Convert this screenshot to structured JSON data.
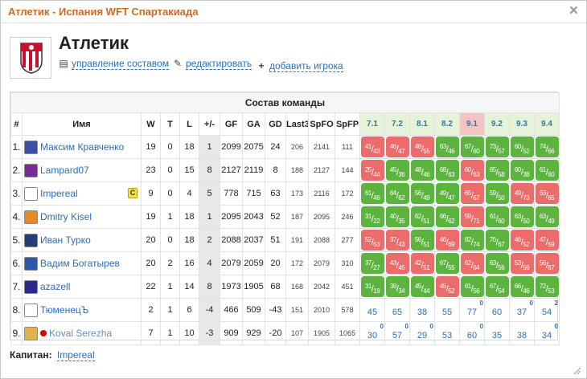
{
  "window": {
    "title": "Атлетик - Испания WFT Спартакиада",
    "close": "×"
  },
  "team": {
    "name": "Атлетик"
  },
  "actions": [
    {
      "label": "управление составом",
      "icon": "list-icon"
    },
    {
      "label": "редактировать",
      "icon": "pencil-icon"
    },
    {
      "label": "добавить игрока",
      "icon": "plus-icon"
    }
  ],
  "table": {
    "caption": "Состав команды",
    "headers": [
      "#",
      "Имя",
      "W",
      "T",
      "L",
      "+/-",
      "GF",
      "GA",
      "GD",
      "Last3",
      "SpFO",
      "SpFP"
    ],
    "match_headers": [
      "7.1",
      "7.2",
      "8.1",
      "8.2",
      "9.1",
      "9.2",
      "9.3",
      "9.4"
    ],
    "rows": [
      {
        "num": "1.",
        "name": "Максим Кравченко",
        "w": "19",
        "t": "0",
        "l": "18",
        "pm": "1",
        "gf": "2099",
        "ga": "2075",
        "gd": "24",
        "last3": "206",
        "spfo": "2141",
        "spfp": "111",
        "cells": [
          {
            "a": "41",
            "b": "43",
            "c": "r"
          },
          {
            "a": "46",
            "b": "47",
            "c": "r"
          },
          {
            "a": "48",
            "b": "55",
            "c": "r"
          },
          {
            "a": "63",
            "b": "46",
            "c": "g"
          },
          {
            "a": "67",
            "b": "60",
            "c": "g"
          },
          {
            "a": "73",
            "b": "57",
            "c": "g"
          },
          {
            "a": "60",
            "b": "52",
            "c": "g"
          },
          {
            "a": "74",
            "b": "66",
            "c": "g"
          }
        ]
      },
      {
        "num": "2.",
        "name": "Lampard07",
        "w": "23",
        "t": "0",
        "l": "15",
        "pm": "8",
        "gf": "2127",
        "ga": "2119",
        "gd": "8",
        "last3": "188",
        "spfo": "2127",
        "spfp": "144",
        "cells": [
          {
            "a": "25",
            "b": "44",
            "c": "r"
          },
          {
            "a": "45",
            "b": "36",
            "c": "g"
          },
          {
            "a": "48",
            "b": "46",
            "c": "g"
          },
          {
            "a": "68",
            "b": "63",
            "c": "g"
          },
          {
            "a": "60",
            "b": "63",
            "c": "r"
          },
          {
            "a": "65",
            "b": "58",
            "c": "g"
          },
          {
            "a": "60",
            "b": "38",
            "c": "g"
          },
          {
            "a": "61",
            "b": "60",
            "c": "g"
          }
        ]
      },
      {
        "num": "3.",
        "name": "Impereal",
        "captain": "C",
        "w": "9",
        "t": "0",
        "l": "4",
        "pm": "5",
        "gf": "778",
        "ga": "715",
        "gd": "63",
        "last3": "173",
        "spfo": "2116",
        "spfp": "172",
        "cells": [
          {
            "a": "61",
            "b": "46",
            "c": "g"
          },
          {
            "a": "64",
            "b": "62",
            "c": "g"
          },
          {
            "a": "56",
            "b": "49",
            "c": "g"
          },
          {
            "a": "49",
            "b": "47",
            "c": "g"
          },
          {
            "a": "65",
            "b": "67",
            "c": "r"
          },
          {
            "a": "59",
            "b": "50",
            "c": "g"
          },
          {
            "a": "49",
            "b": "73",
            "c": "r"
          },
          {
            "a": "63",
            "b": "65",
            "c": "r"
          }
        ]
      },
      {
        "num": "4.",
        "name": "Dmitry Kisel",
        "w": "19",
        "t": "1",
        "l": "18",
        "pm": "1",
        "gf": "2095",
        "ga": "2043",
        "gd": "52",
        "last3": "187",
        "spfo": "2095",
        "spfp": "246",
        "cells": [
          {
            "a": "31",
            "b": "22",
            "c": "g"
          },
          {
            "a": "40",
            "b": "35",
            "c": "g"
          },
          {
            "a": "62",
            "b": "51",
            "c": "g"
          },
          {
            "a": "66",
            "b": "62",
            "c": "g"
          },
          {
            "a": "59",
            "b": "71",
            "c": "r"
          },
          {
            "a": "61",
            "b": "60",
            "c": "g"
          },
          {
            "a": "63",
            "b": "50",
            "c": "g"
          },
          {
            "a": "63",
            "b": "49",
            "c": "g"
          }
        ]
      },
      {
        "num": "5.",
        "name": "Иван Турко",
        "w": "20",
        "t": "0",
        "l": "18",
        "pm": "2",
        "gf": "2088",
        "ga": "2037",
        "gd": "51",
        "last3": "191",
        "spfo": "2088",
        "spfp": "277",
        "cells": [
          {
            "a": "52",
            "b": "53",
            "c": "r"
          },
          {
            "a": "37",
            "b": "43",
            "c": "r"
          },
          {
            "a": "56",
            "b": "51",
            "c": "g"
          },
          {
            "a": "46",
            "b": "69",
            "c": "r"
          },
          {
            "a": "82",
            "b": "74",
            "c": "g"
          },
          {
            "a": "76",
            "b": "67",
            "c": "g"
          },
          {
            "a": "46",
            "b": "52",
            "c": "r"
          },
          {
            "a": "47",
            "b": "59",
            "c": "r"
          }
        ]
      },
      {
        "num": "6.",
        "name": "Вадим Богатырев",
        "w": "20",
        "t": "2",
        "l": "16",
        "pm": "4",
        "gf": "2079",
        "ga": "2059",
        "gd": "20",
        "last3": "172",
        "spfo": "2079",
        "spfp": "310",
        "cells": [
          {
            "a": "37",
            "b": "27",
            "c": "g"
          },
          {
            "a": "43",
            "b": "45",
            "c": "r"
          },
          {
            "a": "42",
            "b": "51",
            "c": "r"
          },
          {
            "a": "67",
            "b": "55",
            "c": "g"
          },
          {
            "a": "62",
            "b": "64",
            "c": "r"
          },
          {
            "a": "63",
            "b": "56",
            "c": "g"
          },
          {
            "a": "53",
            "b": "56",
            "c": "r"
          },
          {
            "a": "56",
            "b": "67",
            "c": "r"
          }
        ]
      },
      {
        "num": "7.",
        "name": "azazell",
        "w": "22",
        "t": "1",
        "l": "14",
        "pm": "8",
        "gf": "1973",
        "ga": "1905",
        "gd": "68",
        "last3": "168",
        "spfo": "2042",
        "spfp": "451",
        "cells": [
          {
            "a": "31",
            "b": "19",
            "c": "g"
          },
          {
            "a": "39",
            "b": "34",
            "c": "g"
          },
          {
            "a": "45",
            "b": "44",
            "c": "g"
          },
          {
            "a": "45",
            "b": "52",
            "c": "r"
          },
          {
            "a": "61",
            "b": "56",
            "c": "g"
          },
          {
            "a": "67",
            "b": "54",
            "c": "g"
          },
          {
            "a": "66",
            "b": "46",
            "c": "g"
          },
          {
            "a": "72",
            "b": "53",
            "c": "g"
          }
        ]
      },
      {
        "num": "8.",
        "name": "ТюменецЪ",
        "w": "2",
        "t": "1",
        "l": "6",
        "pm": "-4",
        "gf": "466",
        "ga": "509",
        "gd": "-43",
        "last3": "151",
        "spfo": "2010",
        "spfp": "578",
        "plain": [
          {
            "v": "45",
            "s": ""
          },
          {
            "v": "65",
            "s": ""
          },
          {
            "v": "38",
            "s": ""
          },
          {
            "v": "55",
            "s": ""
          },
          {
            "v": "77",
            "s": "0"
          },
          {
            "v": "60",
            "s": ""
          },
          {
            "v": "37",
            "s": "0"
          },
          {
            "v": "54",
            "s": "2"
          }
        ]
      },
      {
        "num": "9.",
        "name": "Koval Serezha",
        "w": "7",
        "t": "1",
        "l": "10",
        "pm": "-3",
        "gf": "909",
        "ga": "929",
        "gd": "-20",
        "last3": "107",
        "spfo": "1905",
        "spfp": "1065",
        "plain": [
          {
            "v": "30",
            "s": "0"
          },
          {
            "v": "57",
            "s": "0"
          },
          {
            "v": "29",
            "s": "0"
          },
          {
            "v": "53",
            "s": ""
          },
          {
            "v": "60",
            "s": "0"
          },
          {
            "v": "35",
            "s": ""
          },
          {
            "v": "38",
            "s": ""
          },
          {
            "v": "34",
            "s": "0"
          }
        ]
      }
    ]
  },
  "footer": {
    "label": "Капитан:",
    "captain": "Impereal"
  }
}
